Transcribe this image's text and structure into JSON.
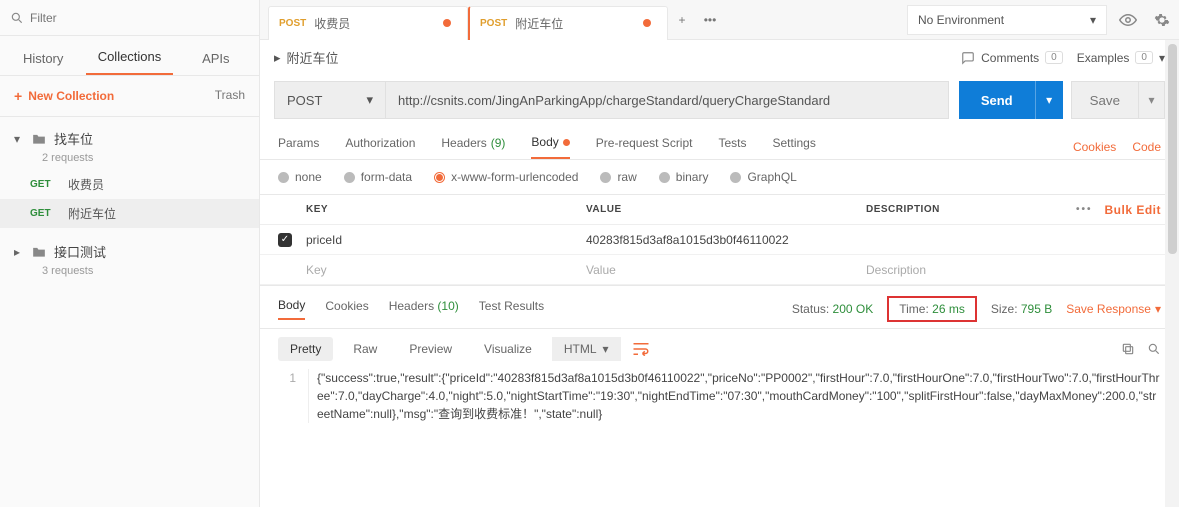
{
  "sidebar": {
    "filter_placeholder": "Filter",
    "tabs": {
      "history": "History",
      "collections": "Collections",
      "apis": "APIs"
    },
    "new_collection": "New Collection",
    "trash": "Trash",
    "collections": [
      {
        "name": "找车位",
        "sub": "2 requests",
        "open": true,
        "items": [
          {
            "method": "GET",
            "name": "收费员",
            "active": false
          },
          {
            "method": "GET",
            "name": "附近车位",
            "active": true
          }
        ]
      },
      {
        "name": "接口测试",
        "sub": "3 requests",
        "open": false,
        "items": []
      }
    ]
  },
  "tabs": [
    {
      "method": "POST",
      "name": "收费员",
      "dirty": true,
      "active": false
    },
    {
      "method": "POST",
      "name": "附近车位",
      "dirty": true,
      "active": true
    }
  ],
  "env": {
    "selected": "No Environment"
  },
  "breadcrumb": {
    "title": "附近车位"
  },
  "comments": {
    "label": "Comments",
    "count": "0"
  },
  "examples": {
    "label": "Examples",
    "count": "0"
  },
  "request": {
    "method": "POST",
    "url": "http://csnits.com/JingAnParkingApp/chargeStandard/queryChargeStandard",
    "send": "Send",
    "save": "Save"
  },
  "req_tabs": {
    "params": "Params",
    "auth": "Authorization",
    "headers": "Headers",
    "headers_count": "(9)",
    "body": "Body",
    "prereq": "Pre-request Script",
    "tests": "Tests",
    "settings": "Settings",
    "cookies": "Cookies",
    "code": "Code"
  },
  "body_types": {
    "none": "none",
    "form": "form-data",
    "url": "x-www-form-urlencoded",
    "raw": "raw",
    "binary": "binary",
    "graphql": "GraphQL"
  },
  "kv": {
    "head_key": "KEY",
    "head_value": "VALUE",
    "head_desc": "DESCRIPTION",
    "bulk": "Bulk Edit",
    "rows": [
      {
        "checked": true,
        "key": "priceId",
        "value": "40283f815d3af8a1015d3b0f46110022",
        "desc": ""
      }
    ],
    "ph_key": "Key",
    "ph_value": "Value",
    "ph_desc": "Description"
  },
  "resp_tabs": {
    "body": "Body",
    "cookies": "Cookies",
    "headers": "Headers",
    "headers_count": "(10)",
    "tests": "Test Results"
  },
  "status": {
    "status_lbl": "Status:",
    "status_val": "200 OK",
    "time_lbl": "Time:",
    "time_val": "26 ms",
    "size_lbl": "Size:",
    "size_val": "795 B",
    "save_resp": "Save Response"
  },
  "view_opts": {
    "pretty": "Pretty",
    "raw": "Raw",
    "preview": "Preview",
    "visualize": "Visualize",
    "format": "HTML"
  },
  "response": {
    "line_no": "1",
    "body": "{\"success\":true,\"result\":{\"priceId\":\"40283f815d3af8a1015d3b0f46110022\",\"priceNo\":\"PP0002\",\"firstHour\":7.0,\"firstHourOne\":7.0,\"firstHourTwo\":7.0,\"firstHourThree\":7.0,\"dayCharge\":4.0,\"night\":5.0,\"nightStartTime\":\"19:30\",\"nightEndTime\":\"07:30\",\"mouthCardMoney\":\"100\",\"splitFirstHour\":false,\"dayMaxMoney\":200.0,\"streetName\":null},\"msg\":\"查询到收费标准！\",\"state\":null}"
  }
}
